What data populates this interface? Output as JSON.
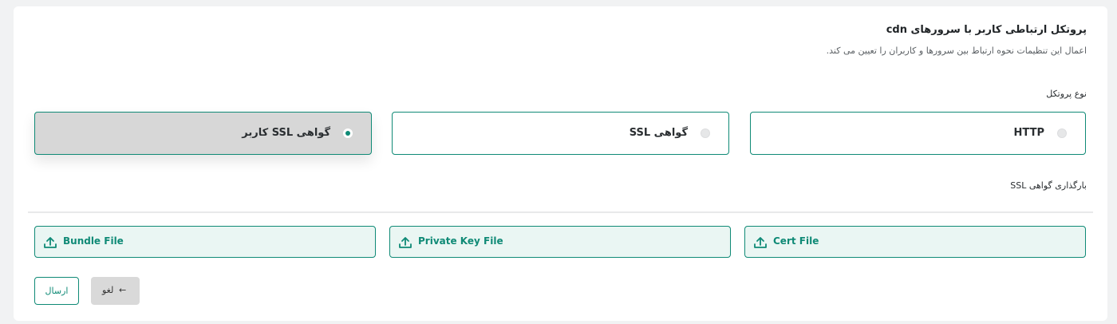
{
  "header": {
    "title": "پروتکل ارتباطی کاربر با سرورهای cdn",
    "subtitle": "اعمال این تنظیمات نحوه ارتباط بین سرورها و کاربران را تعیین می کند."
  },
  "protocol": {
    "label": "نوع پروتکل",
    "options": [
      {
        "label": "HTTP",
        "selected": false
      },
      {
        "label": "گواهی SSL",
        "selected": false
      },
      {
        "label": "گواهی SSL کاربر",
        "selected": true
      }
    ]
  },
  "ssl_upload": {
    "label": "بارگذاری گواهی SSL",
    "files": [
      {
        "label": "Cert File",
        "icon": "upload-icon"
      },
      {
        "label": "Private Key File",
        "icon": "upload-icon"
      },
      {
        "label": "Bundle File",
        "icon": "upload-icon"
      }
    ]
  },
  "actions": {
    "submit_label": "ارسال",
    "cancel_label": "لغو",
    "cancel_icon": "arrow-left-icon"
  },
  "colors": {
    "accent": "#0f8a76",
    "upload_bg": "#eaf6f3",
    "selected_bg": "#d7d7d7"
  }
}
